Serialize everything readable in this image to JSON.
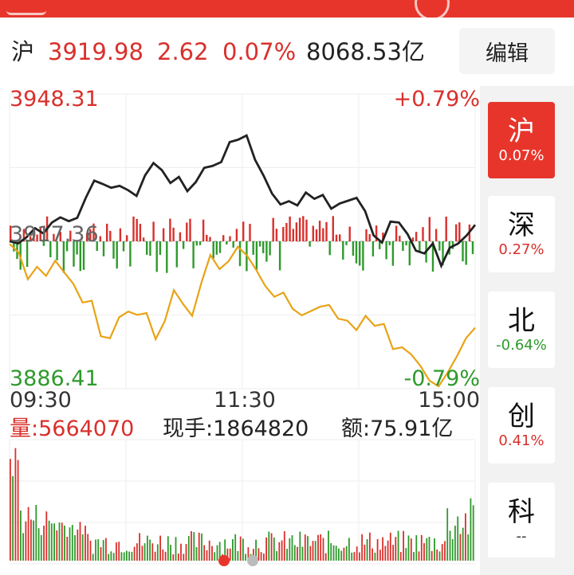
{
  "index": {
    "name": "沪",
    "price": "3919.98",
    "change": "2.62",
    "change_pct": "0.07%",
    "turnover": "8068.53亿",
    "edit_label": "编辑"
  },
  "chart_data": {
    "type": "line",
    "y_max_label": "3948.31",
    "y_mid_label": "3917.36",
    "y_min_label": "3886.41",
    "pct_max_label": "+0.79%",
    "pct_min_label": "-0.79%",
    "time_labels": [
      "09:30",
      "11:30",
      "15:00"
    ],
    "ylim": [
      3886.41,
      3948.31
    ],
    "prev_close": 3917.36,
    "series": [
      {
        "values": [
          3917.4,
          3916.9,
          3918.2,
          3920.1,
          3919.0,
          3921.3,
          3922.4,
          3921.6,
          3922.3,
          3926.5,
          3930.1,
          3929.4,
          3928.6,
          3929.0,
          3928.1,
          3926.9,
          3931.2,
          3933.8,
          3932.3,
          3929.6,
          3930.9,
          3927.9,
          3929.8,
          3932.8,
          3933.2,
          3934.0,
          3938.2,
          3938.7,
          3939.6,
          3934.5,
          3931.2,
          3927.4,
          3925.1,
          3925.8,
          3924.9,
          3927.6,
          3926.3,
          3927.1,
          3924.2,
          3925.3,
          3925.9,
          3926.5,
          3923.7,
          3918.6,
          3917.1,
          3921.5,
          3921.3,
          3918.9,
          3915.4,
          3914.8,
          3916.9,
          3912.2,
          3916.0,
          3916.9,
          3918.6,
          3920.8
        ]
      },
      {
        "values": [
          3916.8,
          3915.0,
          3909.4,
          3912.0,
          3910.1,
          3913.3,
          3910.8,
          3908.4,
          3904.5,
          3904.9,
          3897.4,
          3897.0,
          3901.4,
          3902.6,
          3901.9,
          3902.3,
          3896.8,
          3900.6,
          3907.1,
          3904.2,
          3901.7,
          3908.6,
          3914.5,
          3911.5,
          3913.2,
          3916.2,
          3914.4,
          3911.4,
          3908.0,
          3905.7,
          3906.6,
          3903.2,
          3901.8,
          3902.7,
          3903.6,
          3904.0,
          3901.1,
          3900.7,
          3898.7,
          3901.7,
          3899.6,
          3900.0,
          3894.7,
          3895.1,
          3893.6,
          3891.2,
          3888.1,
          3886.9,
          3889.8,
          3893.2,
          3897.0,
          3899.2
        ]
      }
    ],
    "volume_label": "量:5664070",
    "hand_label": "现手:1864820",
    "amount_label": "额:75.91亿"
  },
  "side_tabs": [
    {
      "name": "沪",
      "pct": "0.07%",
      "color": "#ffffff",
      "active": true
    },
    {
      "name": "深",
      "pct": "0.27%",
      "color": "#d9302c",
      "active": false
    },
    {
      "name": "北",
      "pct": "-0.64%",
      "color": "#2e9a2b",
      "active": false
    },
    {
      "name": "创",
      "pct": "0.41%",
      "color": "#d9302c",
      "active": false
    },
    {
      "name": "科",
      "pct": "--",
      "color": "#333333",
      "active": false
    }
  ],
  "colors": {
    "up": "#d9302c",
    "down": "#2e9a2b",
    "index_line": "#222222",
    "avg_line": "#e8a316",
    "accent": "#e8352b"
  }
}
